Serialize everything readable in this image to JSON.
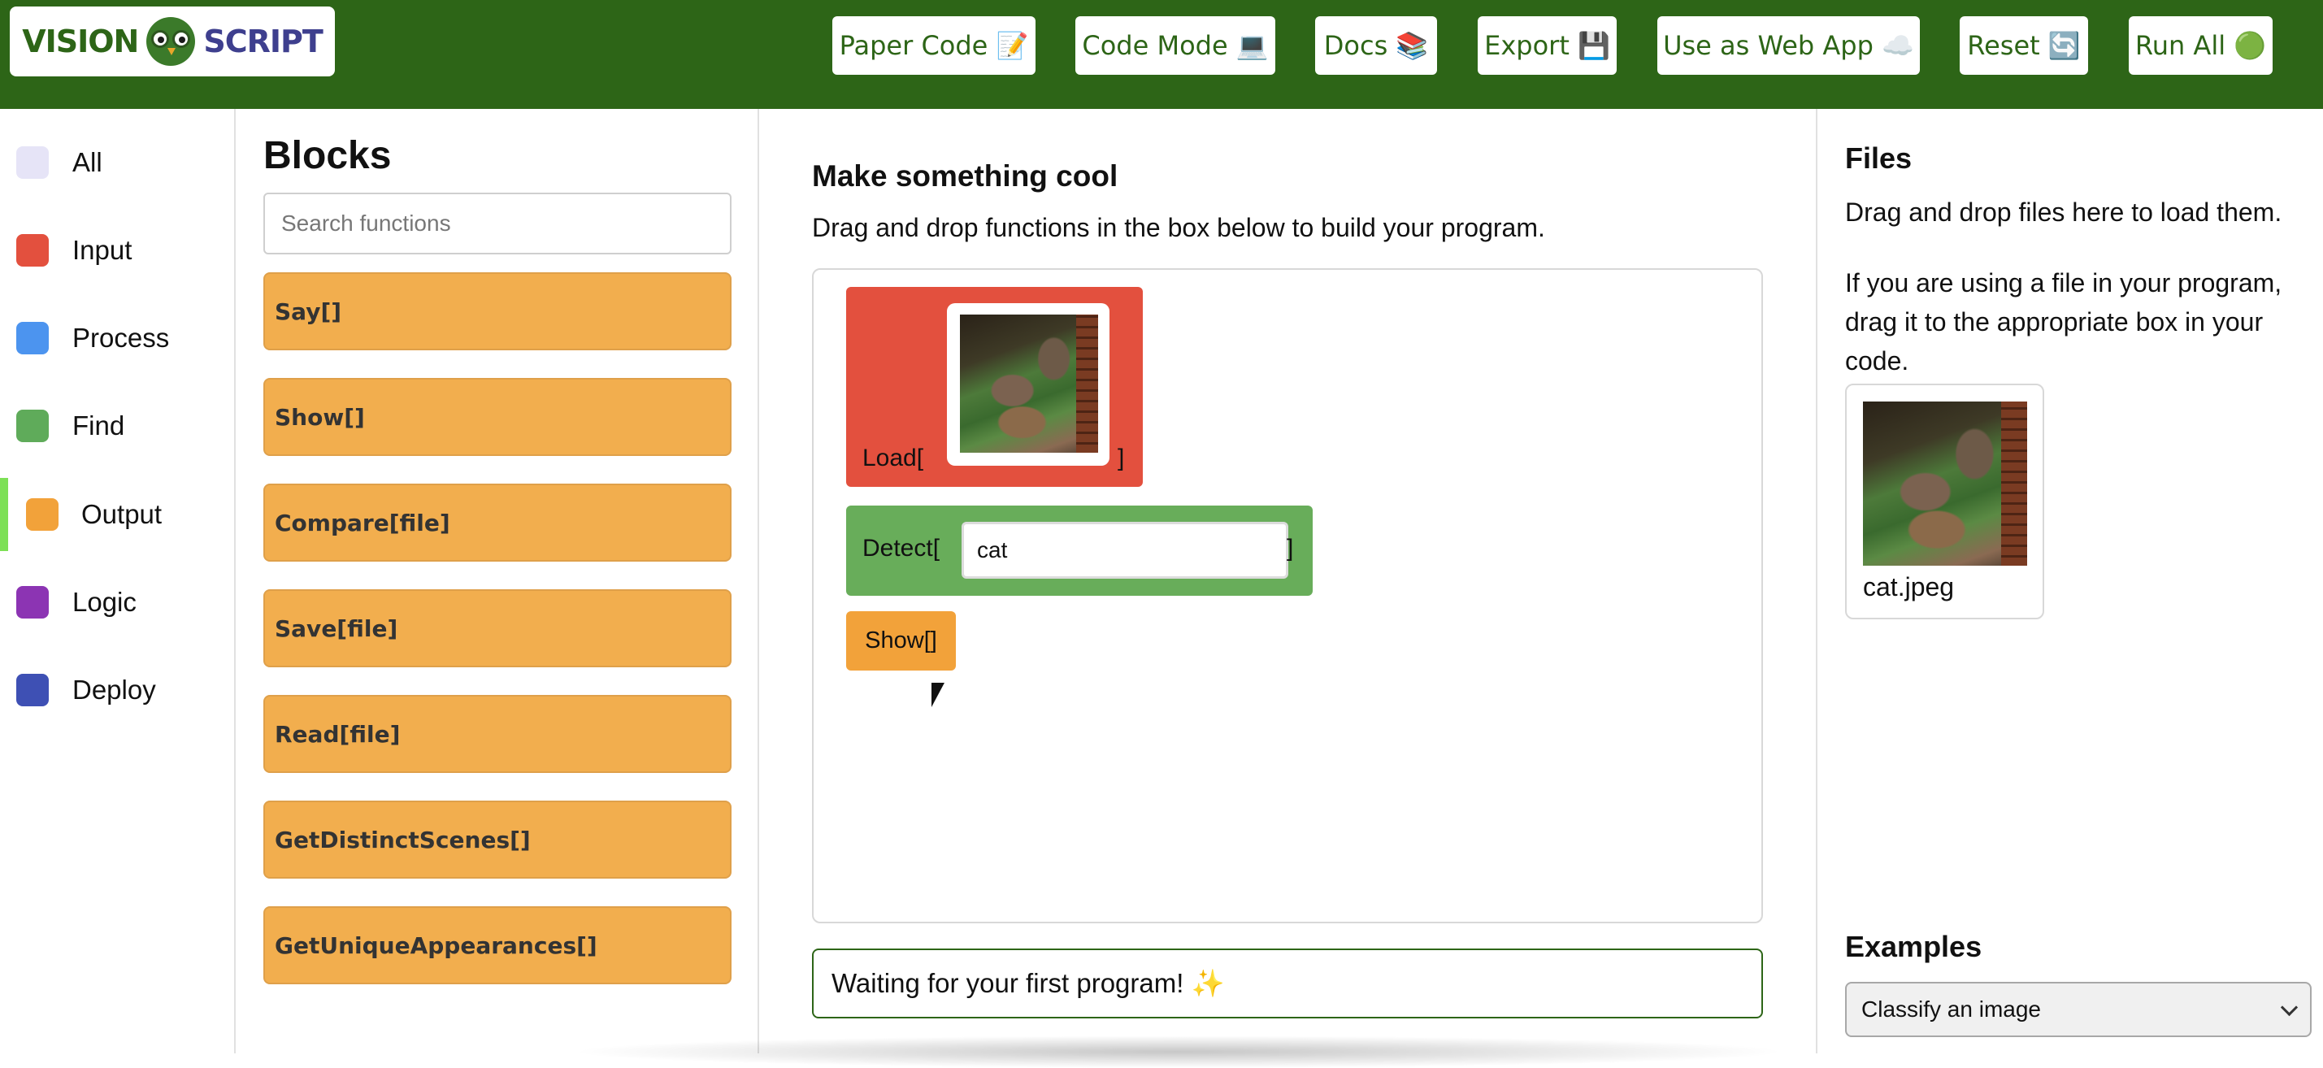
{
  "header": {
    "logo_left": "VISION",
    "logo_right": "SCRIPT",
    "buttons": [
      {
        "label": "Paper Code 📝"
      },
      {
        "label": "Code Mode 💻"
      },
      {
        "label": "Docs 📚"
      },
      {
        "label": "Export 💾"
      },
      {
        "label": "Use as Web App ☁️"
      },
      {
        "label": "Reset 🔄"
      },
      {
        "label": "Run All 🟢"
      }
    ],
    "colors": {
      "bar": "#2d6517"
    }
  },
  "categories": [
    {
      "label": "All",
      "color": "#e6e4f7"
    },
    {
      "label": "Input",
      "color": "#e3503e"
    },
    {
      "label": "Process",
      "color": "#4c94ef"
    },
    {
      "label": "Find",
      "color": "#5fab5a"
    },
    {
      "label": "Output",
      "color": "#f2a23a",
      "active": true
    },
    {
      "label": "Logic",
      "color": "#8c34b3"
    },
    {
      "label": "Deploy",
      "color": "#3e50b4"
    }
  ],
  "blocks_panel": {
    "title": "Blocks",
    "search_placeholder": "Search functions",
    "items": [
      {
        "label": "Say[]"
      },
      {
        "label": "Show[]"
      },
      {
        "label": "Compare[file]"
      },
      {
        "label": "Save[file]"
      },
      {
        "label": "Read[file]"
      },
      {
        "label": "GetDistinctScenes[]"
      },
      {
        "label": "GetUniqueAppearances[]"
      }
    ]
  },
  "main": {
    "title": "Make something cool",
    "subtitle": "Drag and drop functions in the box below to build your program.",
    "program": {
      "load": {
        "prefix": "Load[",
        "suffix": "]"
      },
      "detect": {
        "prefix": "Detect[",
        "value": "cat",
        "suffix": "]"
      },
      "show": {
        "label": "Show[]"
      }
    },
    "status": "Waiting for your first program! ✨"
  },
  "files_panel": {
    "title": "Files",
    "text1": "Drag and drop files here to load them.",
    "text2": "If you are using a file in your program, drag it to the appropriate box in your code.",
    "file": {
      "name": "cat.jpeg"
    }
  },
  "examples": {
    "title": "Examples",
    "selected": "Classify an image"
  }
}
